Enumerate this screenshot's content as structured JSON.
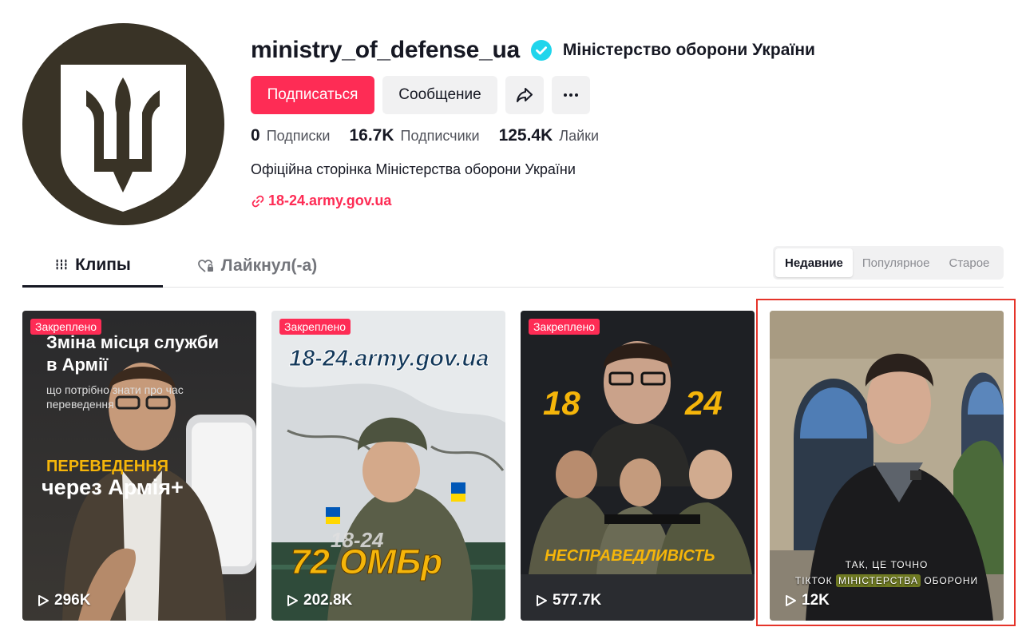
{
  "profile": {
    "username": "ministry_of_defense_ua",
    "nickname": "Міністерство оборони України",
    "bio": "Офіційна сторінка Міністерства оборони України",
    "link": "18-24.army.gov.ua"
  },
  "actions": {
    "follow_label": "Подписаться",
    "message_label": "Сообщение"
  },
  "stats": [
    {
      "value": "0",
      "label": "Подписки"
    },
    {
      "value": "16.7K",
      "label": "Подписчики"
    },
    {
      "value": "125.4K",
      "label": "Лайки"
    }
  ],
  "tabs": {
    "videos": "Клипы",
    "liked": "Лайкнул(-а)"
  },
  "sort": {
    "options": [
      "Недавние",
      "Популярное",
      "Старое"
    ],
    "selected": "Недавние"
  },
  "videos": [
    {
      "pinned": "Закреплено",
      "views": "296K",
      "title_line1": "Зміна місця служби",
      "title_line2": "в Армії",
      "sub_line1": "що потрібно знати про час",
      "sub_line2": "переведення",
      "caption_line1": "ПЕРЕВЕДЕННЯ",
      "caption_line2": "через Армія+"
    },
    {
      "pinned": "Закреплено",
      "views": "202.8K",
      "top_text": "18-24.army.gov.ua",
      "mid_text": "18-24",
      "big_text": "72 ОМБр"
    },
    {
      "pinned": "Закреплено",
      "views": "577.7K",
      "left_num": "18",
      "right_num": "24",
      "caption": "НЕСПРАВЕДЛИВІСТЬ"
    },
    {
      "views": "12K",
      "subtitle_line1": "ТАК, ЦЕ ТОЧНО",
      "subtitle_line2a": "ТІКТОК",
      "subtitle_line2b": "МІНІСТЕРСТВА",
      "subtitle_line2c": "ОБОРОНИ"
    }
  ],
  "colors": {
    "accent": "#fe2c55",
    "verified": "#20d5ec",
    "avatar_bg": "#393326",
    "highlight": "#e5342a"
  }
}
